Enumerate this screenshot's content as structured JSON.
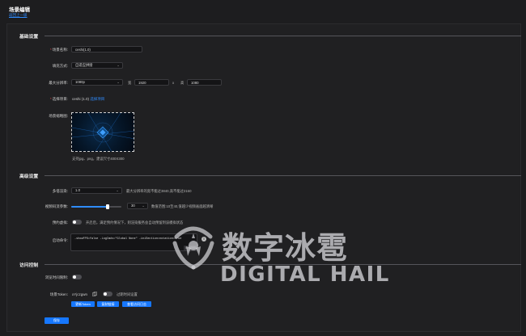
{
  "header": {
    "title": "场景编辑",
    "back": "返回上一级"
  },
  "sections": {
    "basic": "基础设置",
    "advanced": "高级设置",
    "access": "访问控制"
  },
  "basic": {
    "scene_name": {
      "label": "场景名称:",
      "value": "ceshi(1.0)"
    },
    "fill_mode": {
      "label": "填充方式:",
      "value": "自适应拼接"
    },
    "max_resolution": {
      "label": "最大分辨率:",
      "value": "1080p",
      "width_label": "宽",
      "width": "1920",
      "x": "x",
      "height_label": "高",
      "height": "1080"
    },
    "project": {
      "label": "选择项目:",
      "value": "ceshi (1.0)",
      "action": "选择项目"
    },
    "thumbnail": {
      "label": "场景缩略图:",
      "hint": "支持jpg、png，建议尺寸400X300"
    }
  },
  "advanced": {
    "multiview": {
      "label": "多倍渲染:",
      "value": "1.0",
      "hint": "最大分辨率的宽不能过3840,高不能过2160"
    },
    "bitrate": {
      "label": "视频码流参数:",
      "value": "30",
      "hint": "数值范围:10至40,值越少视频画面越清晰",
      "fraction": 0.73
    },
    "preload": {
      "label": "预约虚拟:",
      "hint": "开启后，满足预约情况下，则渲染服务会自动预留到该模拟状态",
      "on": false
    },
    "launch_cmd": {
      "label": "启动命令:",
      "value": "-showFPS=false -LogCmds=\"Global None\" -iniSection=notation=true",
      "counter": "57/1000"
    }
  },
  "access": {
    "browse_limit": {
      "label": "浏览时间限制:",
      "on": false
    },
    "token": {
      "label": "场景Token:",
      "value": "xYjczgwn",
      "copy_icon": "copy-icon",
      "expire_label": "过期时间设置",
      "expire_on": false
    },
    "buttons": {
      "refresh": "更新Token",
      "copy_link": "复制链接",
      "view_log": "查看访问日志"
    }
  },
  "footer": {
    "save": "保存"
  },
  "watermark": {
    "cn": "数字冰雹",
    "en": "DIGITAL HAIL"
  },
  "colors": {
    "accent": "#1677ff",
    "link": "#2f8cff",
    "background": "#1d1d1f"
  }
}
